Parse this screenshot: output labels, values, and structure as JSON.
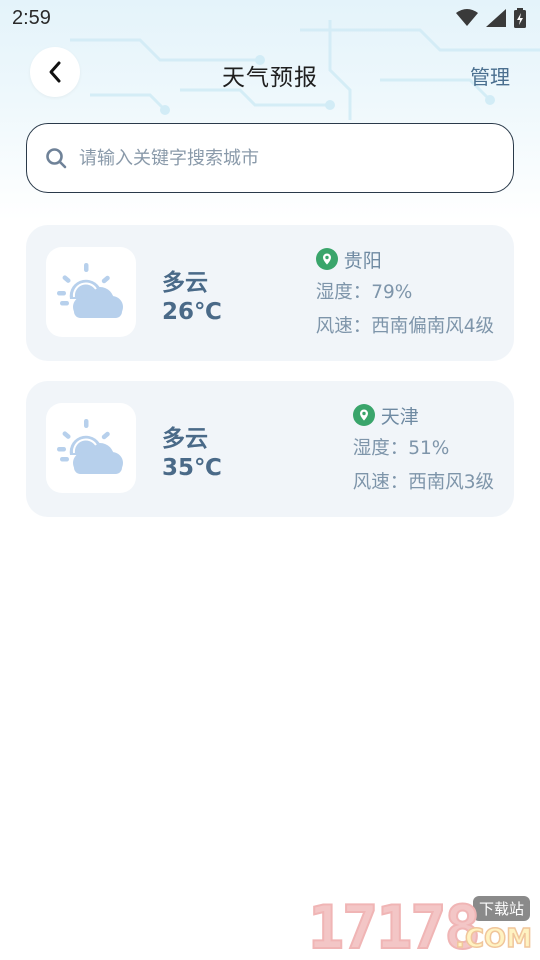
{
  "status_bar": {
    "time": "2:59"
  },
  "header": {
    "title": "天气预报",
    "manage_label": "管理"
  },
  "search": {
    "placeholder": "请输入关键字搜索城市"
  },
  "cards": [
    {
      "condition": "多云",
      "temperature": "26℃",
      "city": "贵阳",
      "humidity": "湿度：79%",
      "wind": "风速：西南偏南风4级",
      "icon": "partly-cloudy-icon"
    },
    {
      "condition": "多云",
      "temperature": "35℃",
      "city": "天津",
      "humidity": "湿度：51%",
      "wind": "风速：西南风3级",
      "icon": "partly-cloudy-icon"
    }
  ],
  "watermark": {
    "digits": "17178",
    "suffix": ".COM",
    "badge": "下载站"
  },
  "colors": {
    "accent_green": "#3aa56b",
    "text_blue": "#4a6a88",
    "card_bg": "#f1f5f9",
    "icon_blue": "#b7d0ec"
  }
}
